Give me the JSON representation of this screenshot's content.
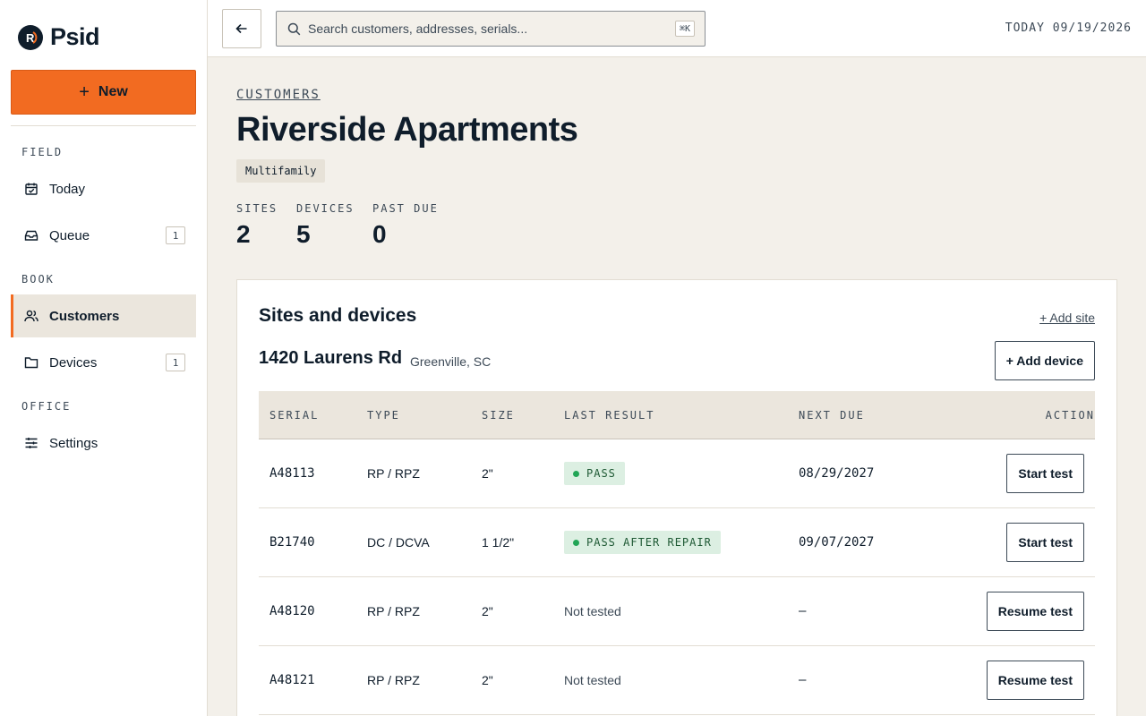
{
  "app": {
    "name": "Psid",
    "logo_letter": "R"
  },
  "sidebar": {
    "new_label": "New",
    "sections": {
      "field": "FIELD",
      "book": "BOOK",
      "office": "OFFICE"
    },
    "items": [
      {
        "label": "Today",
        "icon": "calendar-check-icon"
      },
      {
        "label": "Queue",
        "icon": "inbox-icon",
        "badge": "1"
      },
      {
        "label": "Customers",
        "icon": "users-icon",
        "active": true
      },
      {
        "label": "Devices",
        "icon": "folder-icon",
        "badge": "1"
      },
      {
        "label": "Settings",
        "icon": "sliders-icon"
      }
    ]
  },
  "topbar": {
    "search_placeholder": "Search customers, addresses, serials...",
    "shortcut": "⌘K",
    "today": "TODAY 09/19/2026"
  },
  "page": {
    "breadcrumb": "CUSTOMERS",
    "title": "Riverside Apartments",
    "tag": "Multifamily",
    "stats": [
      {
        "label": "SITES",
        "value": "2"
      },
      {
        "label": "DEVICES",
        "value": "5"
      },
      {
        "label": "PAST DUE",
        "value": "0"
      }
    ]
  },
  "panel": {
    "title": "Sites and devices",
    "add_site": "+ Add site",
    "site": {
      "address": "1420 Laurens Rd",
      "city": "Greenville, SC",
      "add_device": "+ Add device"
    },
    "columns": [
      "SERIAL",
      "TYPE",
      "SIZE",
      "LAST RESULT",
      "NEXT DUE",
      "ACTION"
    ],
    "rows": [
      {
        "serial": "A48113",
        "type": "RP / RPZ",
        "size": "2\"",
        "result": "PASS",
        "result_kind": "badge",
        "next_due": "08/29/2027",
        "action": "Start test"
      },
      {
        "serial": "B21740",
        "type": "DC / DCVA",
        "size": "1 1/2\"",
        "result": "PASS AFTER REPAIR",
        "result_kind": "badge",
        "next_due": "09/07/2027",
        "action": "Start test"
      },
      {
        "serial": "A48120",
        "type": "RP / RPZ",
        "size": "2\"",
        "result": "Not tested",
        "result_kind": "text",
        "next_due": "—",
        "action": "Resume test"
      },
      {
        "serial": "A48121",
        "type": "RP / RPZ",
        "size": "2\"",
        "result": "Not tested",
        "result_kind": "text",
        "next_due": "—",
        "action": "Resume test"
      }
    ]
  },
  "colors": {
    "accent": "#f26b21",
    "navy": "#0f1d2b",
    "pass_bg": "#dcefe2",
    "pass_dot": "#22a556"
  }
}
